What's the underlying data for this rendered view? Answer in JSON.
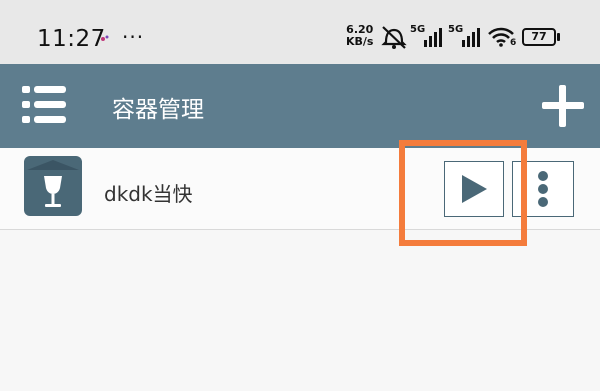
{
  "status_bar": {
    "time": "11:27",
    "more": "···",
    "net_speed_value": "6.20",
    "net_speed_unit": "KB/s",
    "signal1_label": "5G",
    "signal2_label": "5G",
    "wifi_sub": "6",
    "battery": "77"
  },
  "app_bar": {
    "title": "容器管理"
  },
  "containers": [
    {
      "name": "dkdk当快"
    }
  ],
  "colors": {
    "app_bar": "#5e7d8e",
    "accent_dark": "#4a6877",
    "highlight": "#f47c3c"
  }
}
